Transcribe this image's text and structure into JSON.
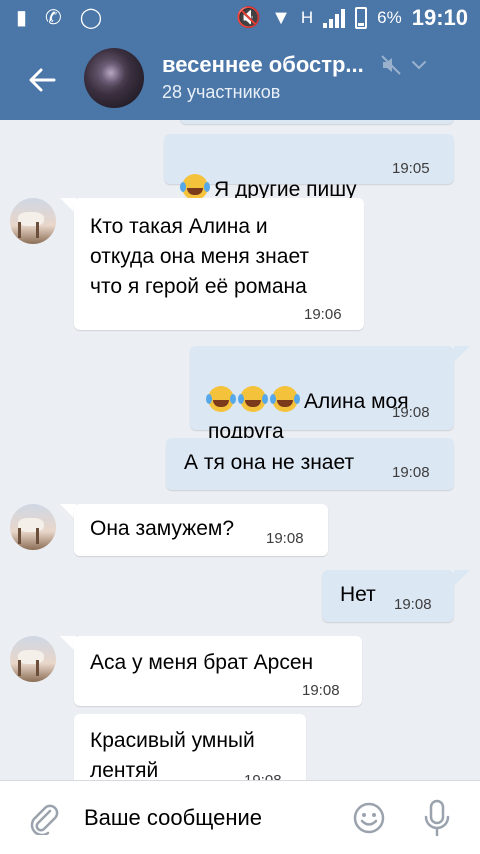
{
  "status_bar": {
    "time": "19:10",
    "battery": "6%",
    "network": "H"
  },
  "header": {
    "title": "весеннее обостр...",
    "subtitle": "28 участников",
    "icons": [
      "back-arrow-icon",
      "mute-icon",
      "dropdown-icon"
    ]
  },
  "messages": [
    {
      "direction": "out",
      "text": "Я другие пишу",
      "emoji_before": 1,
      "time": "19:05"
    },
    {
      "direction": "in",
      "text": "Кто такая Алина и\nоткуда она меня знает\nчто я герой её романа",
      "time": "19:06"
    },
    {
      "direction": "out",
      "text": "Алина моя\nподруга",
      "emoji_before": 3,
      "time": "19:08"
    },
    {
      "direction": "out",
      "text": "А тя она не знает",
      "time": "19:08"
    },
    {
      "direction": "in",
      "text": "Она замужем?",
      "time": "19:08"
    },
    {
      "direction": "out",
      "text": "Нет",
      "time": "19:08"
    },
    {
      "direction": "in",
      "text": "Аса у меня брат Арсен",
      "time": "19:08"
    },
    {
      "direction": "in",
      "text": "Красивый умный\nлентяй",
      "time": "19:08"
    }
  ],
  "input": {
    "placeholder": "Ваше сообщение"
  },
  "colors": {
    "header_bg": "#4a76a8",
    "chat_bg": "#ebeef2",
    "outgoing_bubble": "#dce7f4",
    "incoming_bubble": "#ffffff",
    "icon_gray": "#9aa3ad"
  }
}
